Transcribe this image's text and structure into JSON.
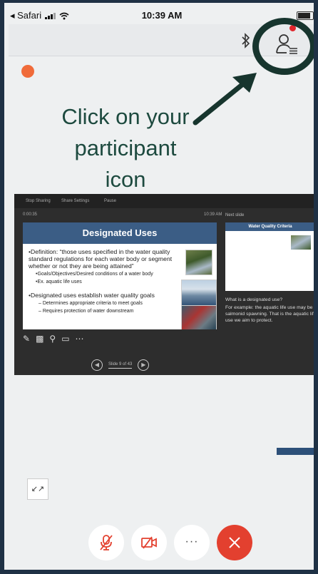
{
  "status_bar": {
    "back_app": "◂ Safari",
    "time": "10:39 AM"
  },
  "callout": {
    "lines": [
      "Click on your",
      "participant",
      "icon"
    ]
  },
  "share": {
    "toolbar": [
      "Stop Sharing",
      "Share Settings",
      "Pause"
    ],
    "slide_meta": "0:00:35",
    "slide_time": "10:39 AM",
    "next_label": "Next slide",
    "slide": {
      "title": "Designated Uses",
      "bullets": [
        "•Definition: “those uses specified in the water quality standard regulations for each water body or segment whether or not they are being attained”",
        "•Goals/Objectives/Desired conditions of a water body",
        "•Ex. aquatic life uses",
        "•Designated uses establish water quality goals",
        "–   Determines appropriate criteria to meet goals",
        "–   Requires protection of water downstream"
      ]
    },
    "next_slide": {
      "title": "Water Quality Criteria"
    },
    "notes": [
      "What is a designated use?",
      "For example: the aquatic life use may be salmonid spawning. That is the aquatic life use we aim to protect."
    ],
    "pager": "Slide 9 of 43"
  }
}
